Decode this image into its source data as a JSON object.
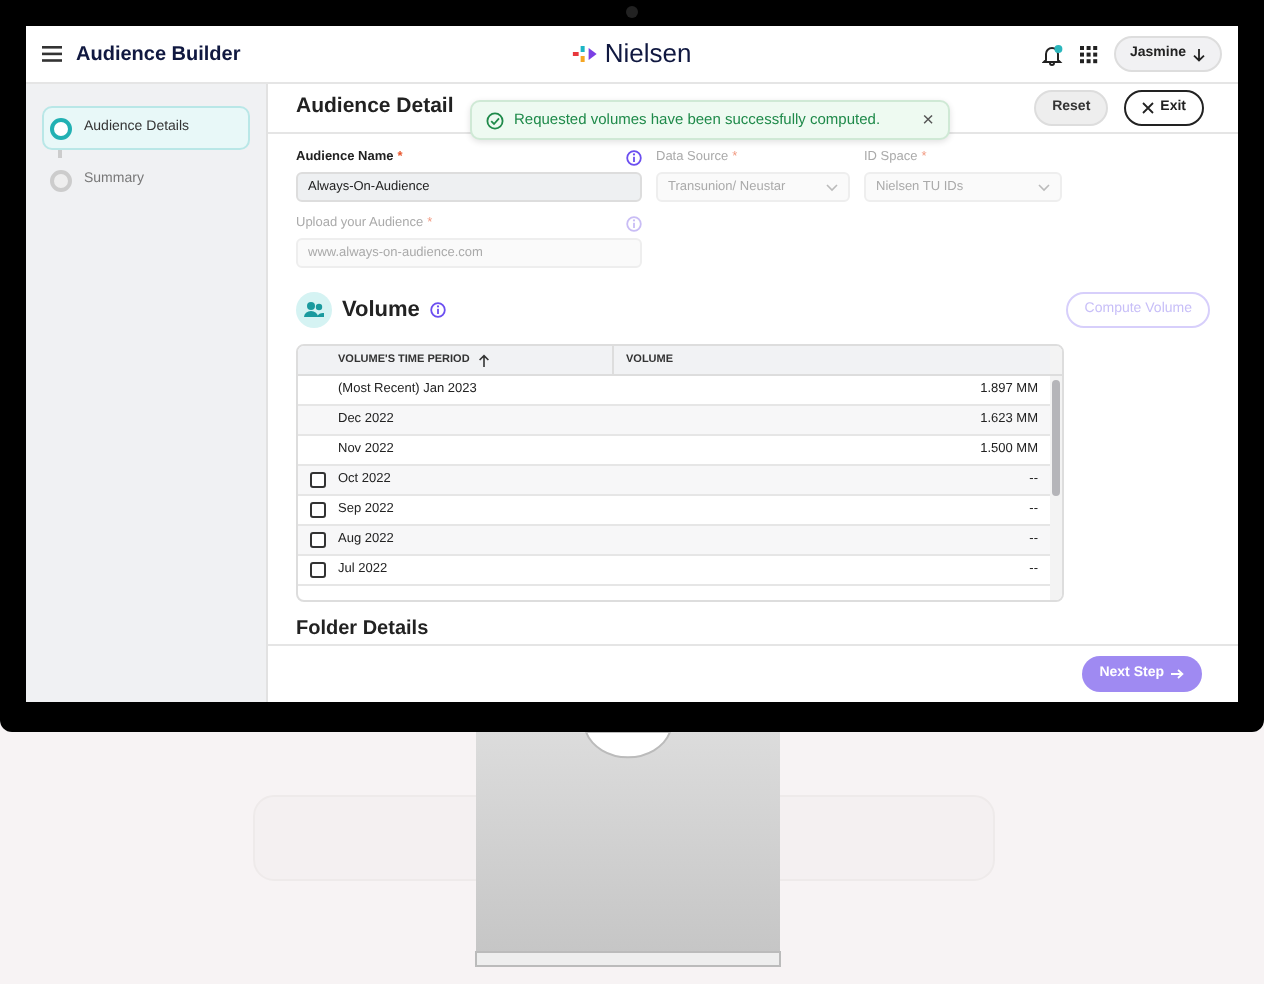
{
  "header": {
    "app_title": "Audience Builder",
    "brand": "Nielsen",
    "notification_unread": true,
    "user": "Jasmine"
  },
  "steps": [
    {
      "label": "Audience Details",
      "selected": true
    },
    {
      "label": "Summary",
      "selected": false
    }
  ],
  "page_title": "Audience Detail",
  "actions": [
    {
      "label": "Reset",
      "kind": "reset"
    },
    {
      "label": "Exit",
      "kind": "exit"
    }
  ],
  "toast": {
    "message": "Requested volumes have been successfully computed.",
    "close": "×"
  },
  "fields": [
    {
      "label": "Audience Name",
      "required_mark": "*",
      "kind": "text",
      "value": "Always-On-Audience",
      "info": true,
      "disabled": false
    },
    {
      "label": "Data Source",
      "required_mark": "*",
      "kind": "select",
      "value": "Transunion/ Neustar",
      "info": false,
      "disabled": true
    },
    {
      "label": "ID Space",
      "required_mark": "*",
      "kind": "select",
      "value": "Nielsen TU IDs",
      "info": false,
      "disabled": true
    },
    {
      "label": "Upload your Audience",
      "required_mark": "*",
      "kind": "text",
      "placeholder": "www.always-on-audience.com",
      "info": true,
      "disabled": true
    }
  ],
  "volume": {
    "title": "Volume",
    "button": {
      "label": "Compute Volume",
      "disabled": true
    },
    "table": {
      "columns": [
        "VOLUME'S TIME PERIOD",
        "VOLUME"
      ],
      "rows": [
        {
          "kind": "computed",
          "period": "(Most Recent) Jan 2023",
          "volume": "1.897 MM"
        },
        {
          "kind": "computed",
          "period": "Dec 2022",
          "volume": "1.623 MM"
        },
        {
          "kind": "computed",
          "period": "Nov 2022",
          "volume": "1.500 MM"
        },
        {
          "kind": "selectable",
          "checked": false,
          "period": "Oct 2022",
          "volume": "--"
        },
        {
          "kind": "selectable",
          "checked": false,
          "period": "Sep 2022",
          "volume": "--"
        },
        {
          "kind": "selectable",
          "checked": false,
          "period": "Aug 2022",
          "volume": "--"
        },
        {
          "kind": "selectable",
          "checked": false,
          "period": "Jul 2022",
          "volume": "--"
        }
      ]
    }
  },
  "next_section": "Folder Details",
  "footer": {
    "button": {
      "label": "Next Step",
      "disabled": true
    }
  }
}
